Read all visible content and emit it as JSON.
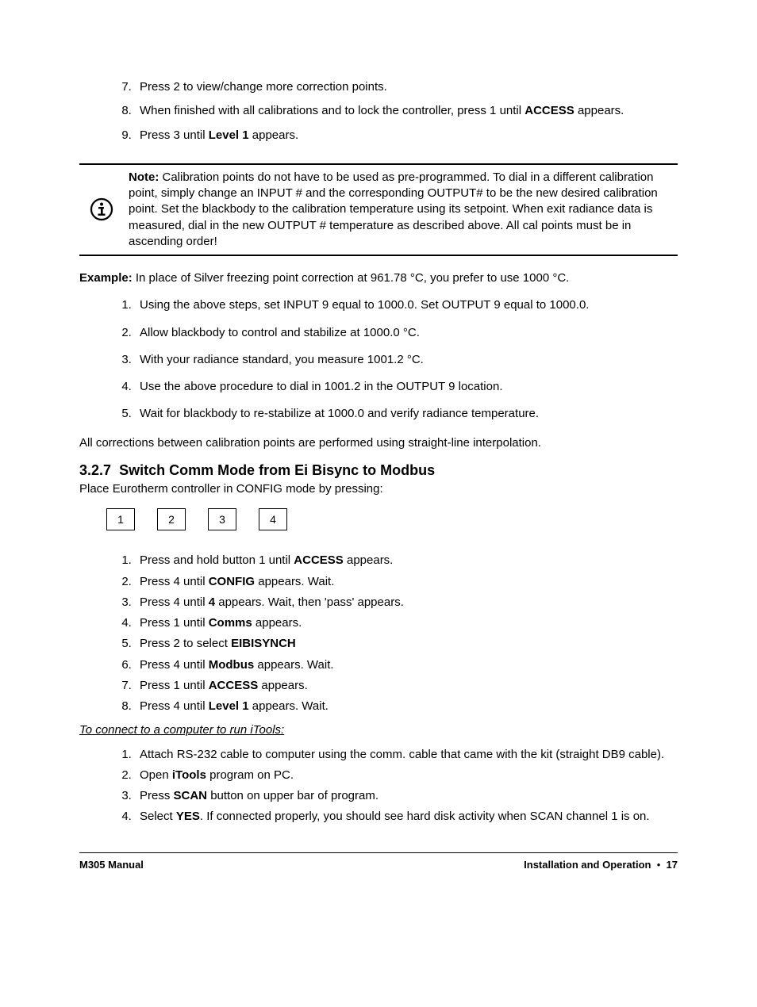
{
  "topList": {
    "item7": {
      "text": "Press 2 to view/change more correction points."
    },
    "item8": {
      "pre": "When finished with all calibrations and to lock the controller, press 1 until ",
      "bold": "ACCESS",
      "post": " appears."
    },
    "item9": {
      "pre": "Press 3 until ",
      "bold": "Level 1",
      "post": " appears."
    }
  },
  "note": {
    "label": "Note:",
    "text": " Calibration points do not have to be used as pre-programmed. To dial in a different calibration point, simply change an INPUT # and the corresponding OUTPUT# to be the new desired calibration point. Set the blackbody to the calibration temperature using its setpoint. When exit radiance data is measured, dial in the new OUTPUT # temperature as described above. All cal points must be in ascending order!"
  },
  "example": {
    "label": "Example:",
    "text": "  In place of Silver freezing point correction at 961.78 °C, you prefer to use 1000 °C.",
    "items": [
      "Using the above steps, set INPUT 9 equal  to 1000.0.  Set OUTPUT 9 equal to 1000.0.",
      "Allow blackbody to control and stabilize at 1000.0 °C.",
      "With your radiance standard, you measure 1001.2 °C.",
      "Use the above procedure to dial in 1001.2 in the OUTPUT 9 location.",
      "Wait for blackbody to re-stabilize at 1000.0 and verify radiance temperature."
    ]
  },
  "interpolation": "All corrections between calibration points are performed using straight-line interpolation.",
  "section": {
    "number": "3.2.7",
    "title": "Switch Comm Mode from Ei Bisync to Modbus",
    "sub": "Place Eurotherm controller in CONFIG mode by pressing:"
  },
  "buttons": [
    "1",
    "2",
    "3",
    "4"
  ],
  "steps": [
    {
      "pre": "Press and hold button 1 until ",
      "bold": "ACCESS",
      "post": " appears."
    },
    {
      "pre": "Press 4 until ",
      "bold": "CONFIG",
      "post": " appears. Wait."
    },
    {
      "pre": "Press 4 until ",
      "bold": "4",
      "post": " appears. Wait, then 'pass' appears."
    },
    {
      "pre": "Press 1 until ",
      "bold": "Comms",
      "post": " appears."
    },
    {
      "pre": "Press 2 to select ",
      "bold": "EIBISYNCH",
      "post": ""
    },
    {
      "pre": "Press 4 until ",
      "bold": "Modbus",
      "post": " appears. Wait."
    },
    {
      "pre": "Press 1 until ",
      "bold": "ACCESS",
      "post": " appears."
    },
    {
      "pre": "Press 4 until ",
      "bold": "Level 1",
      "post": " appears. Wait."
    }
  ],
  "connectHeading": "To connect to a computer to run iTools:",
  "connectSteps": [
    {
      "pre": "Attach RS-232 cable to computer using the comm. cable that came with the kit (straight DB9 cable).",
      "bold": "",
      "post": ""
    },
    {
      "pre": "Open ",
      "bold": "iTools",
      "post": " program on PC."
    },
    {
      "pre": "Press ",
      "bold": "SCAN",
      "post": " button on upper bar of program."
    },
    {
      "pre": "Select ",
      "bold": "YES",
      "post": ". If connected properly, you should see hard disk activity when SCAN channel 1 is on."
    }
  ],
  "footer": {
    "left": "M305 Manual",
    "rightLabel": "Installation and Operation",
    "bullet": "•",
    "page": "17"
  }
}
